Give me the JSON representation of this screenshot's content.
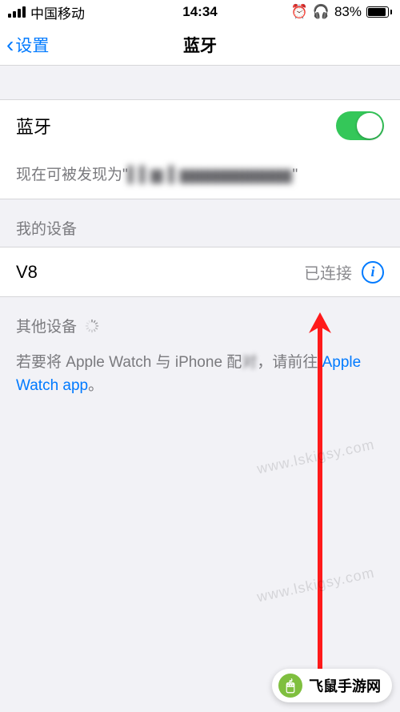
{
  "status": {
    "carrier": "中国移动",
    "time": "14:34",
    "battery_pct": "83%"
  },
  "nav": {
    "back_label": "设置",
    "title": "蓝牙"
  },
  "bluetooth": {
    "label": "蓝牙",
    "on": true
  },
  "discoverable": {
    "prefix": "现在可被发现为\"",
    "name_blurred": "▌▌▆  ▌▆▆▆▆▆▆▆▆▆",
    "suffix": "\""
  },
  "sections": {
    "my_devices": "我的设备",
    "other_devices": "其他设备"
  },
  "devices": [
    {
      "name": "V8",
      "status": "已连接"
    }
  ],
  "footer": {
    "text_pre": "若要将 Apple Watch 与 iPhone 配",
    "text_blur": "对",
    "text_mid": "，请前往 ",
    "link": "Apple Watch app",
    "text_post": "。"
  },
  "watermark": "www.lskigsy.com",
  "badge": "飞鼠手游网",
  "colors": {
    "accent": "#007aff",
    "switch_on": "#34c759",
    "arrow": "#ff1a1a"
  }
}
